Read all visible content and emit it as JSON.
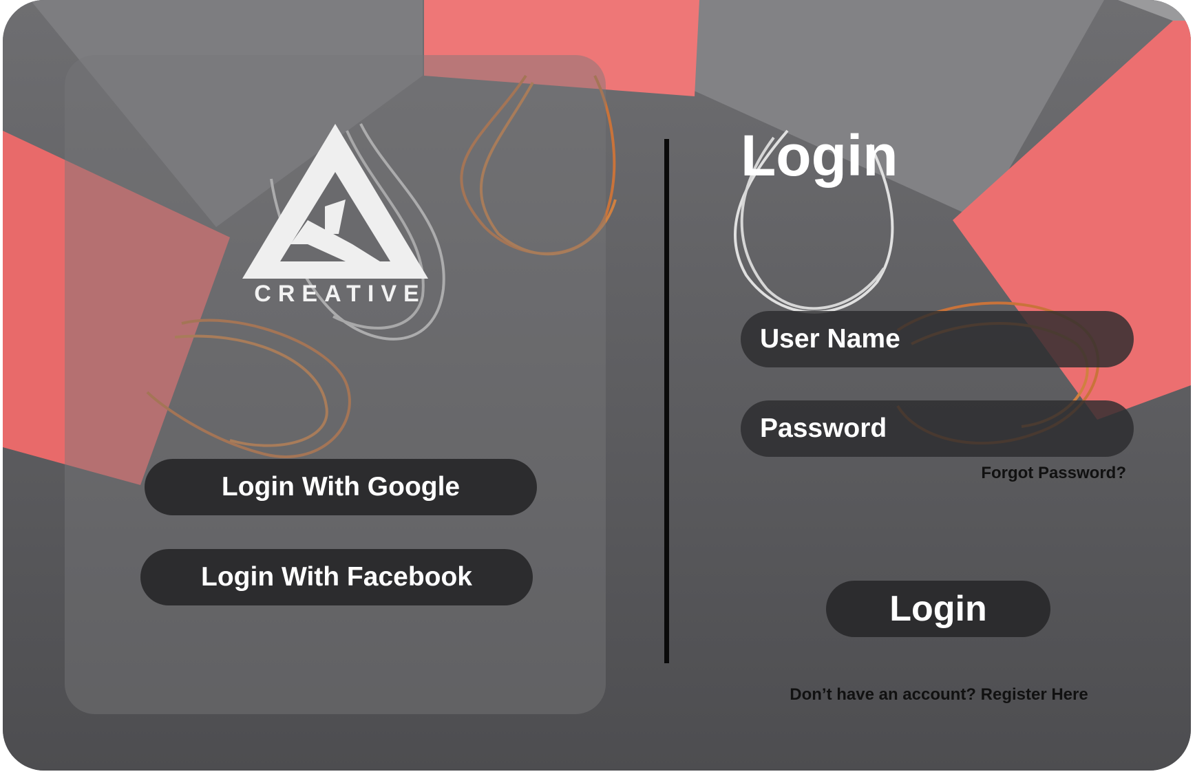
{
  "brand": {
    "logo_text": "CREATIVE"
  },
  "social": {
    "google_label": "Login With Google",
    "facebook_label": "Login With Facebook"
  },
  "form": {
    "title": "Login",
    "username_placeholder": "User Name",
    "password_placeholder": "Password",
    "forgot_label": "Forgot Password?",
    "submit_label": "Login",
    "register_label": "Don’t have an account? Register Here"
  },
  "colors": {
    "button_bg": "#2c2c2e",
    "bag_red": "#e86a6a",
    "background_gray": "#5c5c5e"
  }
}
